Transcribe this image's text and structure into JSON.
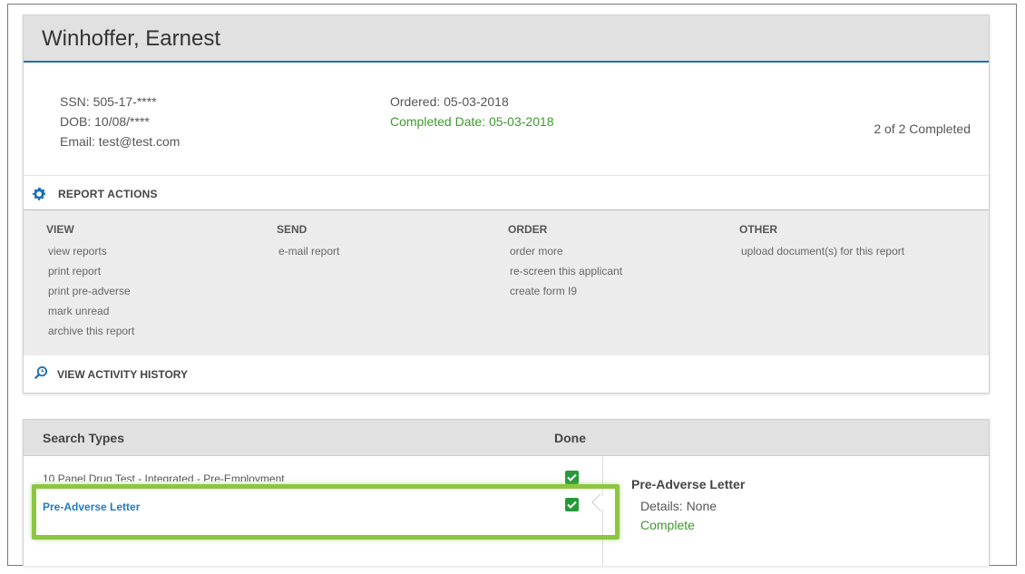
{
  "applicant": {
    "name": "Winhoffer, Earnest",
    "ssn": "SSN: 505-17-****",
    "dob": "DOB: 10/08/****",
    "email": "Email: test@test.com",
    "ordered": "Ordered: 05-03-2018",
    "completed_date": "Completed Date: 05-03-2018",
    "progress": "2 of 2 Completed"
  },
  "report_actions": {
    "title": "REPORT ACTIONS",
    "columns": [
      {
        "heading": "VIEW",
        "items": [
          "view reports",
          "print report",
          "print pre-adverse",
          "mark unread",
          "archive this report"
        ]
      },
      {
        "heading": "SEND",
        "items": [
          "e-mail report"
        ]
      },
      {
        "heading": "ORDER",
        "items": [
          "order more",
          "re-screen this applicant",
          "create form I9"
        ]
      },
      {
        "heading": "OTHER",
        "items": [
          "upload document(s) for this report"
        ]
      }
    ]
  },
  "activity_history": {
    "label": "VIEW ACTIVITY HISTORY"
  },
  "search_types": {
    "col_search": "Search Types",
    "col_done": "Done",
    "rows": [
      {
        "name": "10 Panel Drug Test - Integrated - Pre-Employment",
        "done": true
      },
      {
        "name": "Pre-Adverse Letter",
        "done": true,
        "selected": true
      }
    ],
    "detail": {
      "title": "Pre-Adverse Letter",
      "details": "Details: None",
      "status": "Complete"
    }
  },
  "colors": {
    "accent_blue": "#1f6fb2",
    "link_blue": "#1f7bc2",
    "success_green": "#3d9a2d",
    "check_green": "#269a3a",
    "highlight_green": "#8cc641"
  }
}
